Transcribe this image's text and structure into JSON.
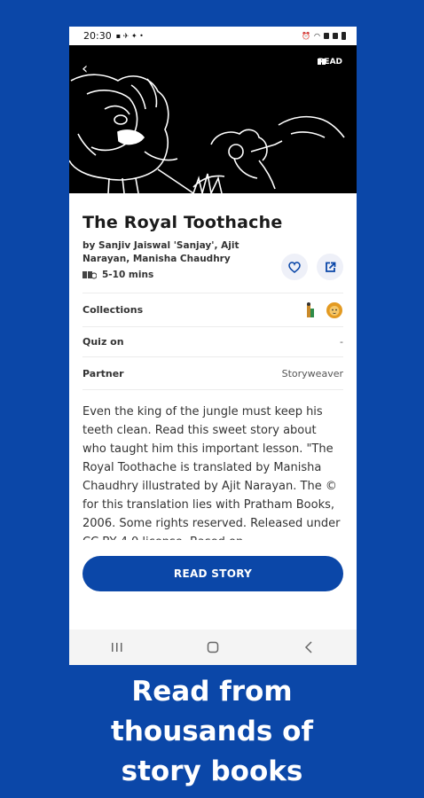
{
  "status_bar": {
    "time": "20:30",
    "dot": "•"
  },
  "hero": {
    "read_label": "READ"
  },
  "book": {
    "title": "The Royal Toothache",
    "authors": "by Sanjiv Jaiswal 'Sanjay', Ajit Narayan, Manisha Chaudhry",
    "duration": "5-10  mins"
  },
  "info": {
    "collections_label": "Collections",
    "quiz_label": "Quiz on",
    "quiz_value": "-",
    "partner_label": "Partner",
    "partner_value": "Storyweaver"
  },
  "description": "Even the king of the jungle must keep his teeth clean. Read this sweet story about who taught him this important lesson. \"The Royal Toothache is translated by Manisha Chaudhry illustrated by Ajit Narayan. The © for this translation lies with Pratham Books, 2006. Some rights reserved. Released under CC BY 4.0 license. Based on",
  "actions": {
    "read_story": "READ STORY"
  },
  "caption": {
    "line1": "Read from",
    "line2": "thousands of",
    "line3": "story books"
  },
  "colors": {
    "brand": "#0b47a8",
    "hero_bg": "#000000"
  },
  "icons": {
    "back": "back-arrow-icon",
    "read": "book-icon",
    "favorite": "heart-icon",
    "share": "share-icon",
    "duration": "book-clock-icon",
    "collection1": "giraffe-collection-icon",
    "collection2": "lion-collection-icon"
  }
}
